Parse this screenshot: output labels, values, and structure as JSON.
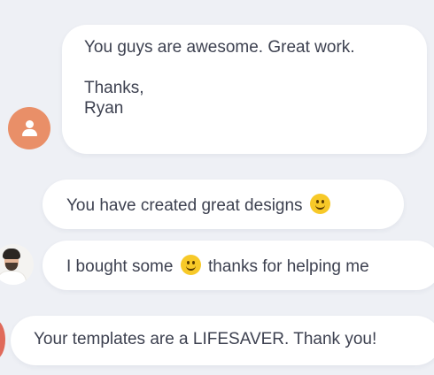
{
  "messages": [
    {
      "lines": [
        "You guys are awesome. Great work.",
        "Thanks,",
        "Ryan"
      ],
      "avatar": "user-placeholder-icon"
    },
    {
      "before_emoji": "You have created great designs",
      "after_emoji": "",
      "emoji": "smiley-emoji-icon"
    },
    {
      "before_emoji": "I bought some",
      "after_emoji": "thanks for helping me",
      "emoji": "smiley-emoji-icon",
      "avatar": "bearded-man-avatar"
    },
    {
      "text": "Your templates are a LIFESAVER. Thank you!"
    }
  ],
  "colors": {
    "background": "#eef0f5",
    "bubble": "#ffffff",
    "text": "#3d4150",
    "avatar_orange": "#e98f68",
    "emoji": "#f7c928"
  }
}
